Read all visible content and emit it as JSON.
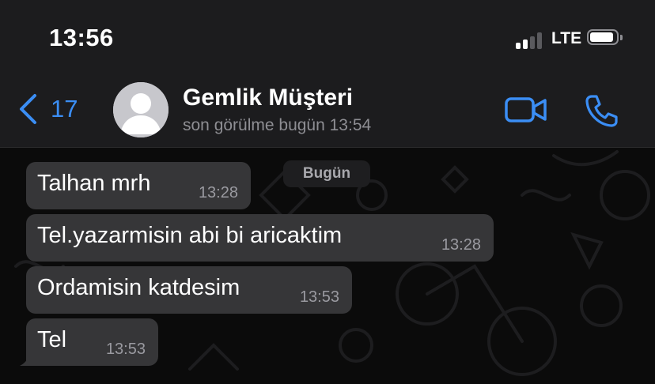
{
  "status_bar": {
    "time": "13:56",
    "network": "LTE",
    "signal_bars_active": 2,
    "signal_bars_total": 4,
    "battery_level": 0.9
  },
  "header": {
    "back_count": "17",
    "contact_name": "Gemlik Müşteri",
    "contact_status": "son görülme bugün 13:54",
    "back_icon": "chevron-left-icon",
    "video_icon": "video-camera-icon",
    "call_icon": "phone-icon",
    "accent_color": "#3b8ef5"
  },
  "chat": {
    "date_label": "Bugün",
    "messages": [
      {
        "text": "Talhan mrh",
        "time": "13:28"
      },
      {
        "text": "Tel.yazarmisin abi bi aricaktim",
        "time": "13:28"
      },
      {
        "text": "Ordamisin katdesim",
        "time": "13:53"
      },
      {
        "text": "Tel",
        "time": "13:53"
      }
    ],
    "bubble_color": "#363638"
  }
}
